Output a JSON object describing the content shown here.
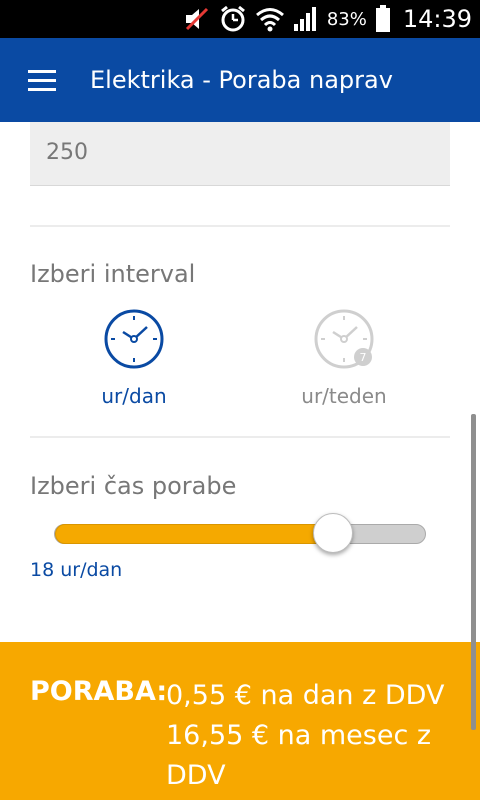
{
  "status_bar": {
    "battery_percent": "83%",
    "time": "14:39"
  },
  "app_bar": {
    "title": "Elektrika - Poraba naprav"
  },
  "power_input": {
    "value": "250"
  },
  "interval": {
    "label": "Izberi interval",
    "options": [
      {
        "label": "ur/dan",
        "selected": true
      },
      {
        "label": "ur/teden",
        "selected": false,
        "badge": "7"
      }
    ]
  },
  "usage_time": {
    "label": "Izberi čas porabe",
    "value_text": "18 ur/dan",
    "fraction": 0.75
  },
  "summary": {
    "label": "PORABA:",
    "lines": [
      "0,55 € na dan z DDV",
      "16,55 € na mesec z DDV"
    ]
  },
  "colors": {
    "primary": "#0a4aa3",
    "accent": "#f7a800",
    "inactive": "#8a8a8a"
  }
}
